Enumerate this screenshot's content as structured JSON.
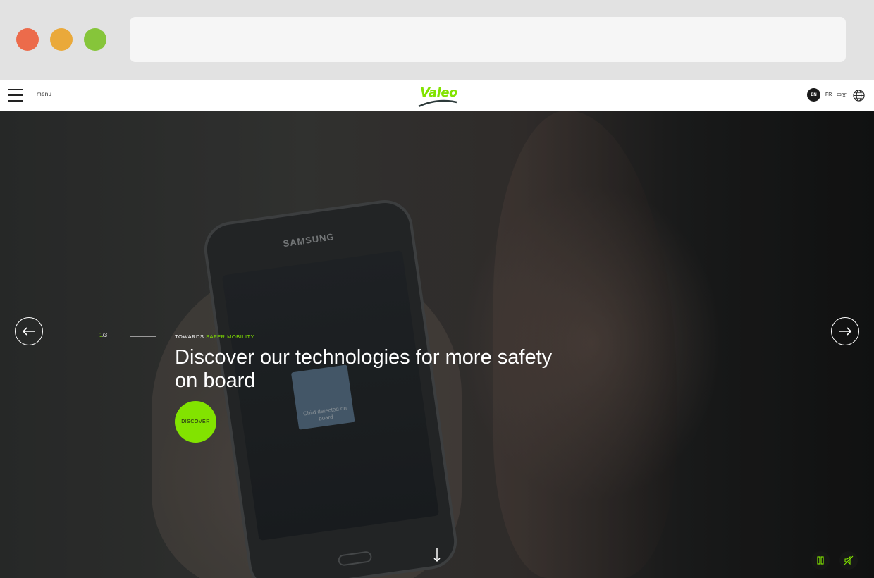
{
  "header": {
    "menu_label": "menu",
    "logo_text": "Valeo",
    "languages": [
      "EN",
      "FR",
      "中文"
    ],
    "active_language": "EN"
  },
  "hero": {
    "counter_current": "1",
    "counter_total": "/3",
    "eyebrow_prefix": "TOWARDS ",
    "eyebrow_accent": "SAFER MOBILITY",
    "headline": "Discover our technologies for more safety on board",
    "cta_label": "DISCOVER",
    "phone_brand": "SAMSUNG",
    "phone_card_text": "Child detected on board"
  },
  "colors": {
    "brand_green": "#82e300",
    "traffic_red": "#ec6b4b",
    "traffic_yellow": "#eaa93a",
    "traffic_green": "#86c53a"
  },
  "icons": {
    "menu": "hamburger-icon",
    "globe": "globe-icon",
    "prev": "arrow-left-icon",
    "next": "arrow-right-icon",
    "scroll": "arrow-down-icon",
    "pause": "pause-icon",
    "mute": "speaker-muted-icon"
  }
}
